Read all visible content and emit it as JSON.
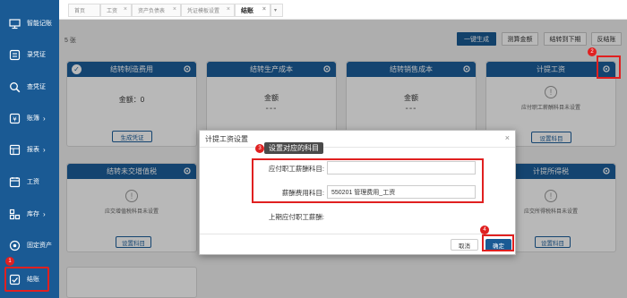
{
  "sidebar": {
    "items": [
      {
        "label": "智能记账",
        "icon": "monitor-icon",
        "chevron": ""
      },
      {
        "label": "录凭证",
        "icon": "voucher-entry-icon",
        "chevron": ""
      },
      {
        "label": "查凭证",
        "icon": "magnifier-icon",
        "chevron": ""
      },
      {
        "label": "账簿",
        "icon": "yen-ledger-icon",
        "chevron": "›"
      },
      {
        "label": "报表",
        "icon": "report-icon",
        "chevron": "›"
      },
      {
        "label": "工资",
        "icon": "salary-icon",
        "chevron": ""
      },
      {
        "label": "库存",
        "icon": "inventory-icon",
        "chevron": "›"
      },
      {
        "label": "固定资产",
        "icon": "fixed-asset-icon",
        "chevron": ""
      },
      {
        "label": "结账",
        "icon": "checkbox-icon",
        "chevron": ""
      }
    ],
    "active_index": 8
  },
  "tabs": [
    {
      "label": "首页",
      "close": ""
    },
    {
      "label": "工资",
      "close": "×"
    },
    {
      "label": "资产负债表",
      "close": "×"
    },
    {
      "label": "凭证模板设置",
      "close": "×"
    },
    {
      "label": "结账",
      "close": "×"
    },
    {
      "label": "▾",
      "close": ""
    }
  ],
  "toolbar": {
    "period_label": "5 张",
    "buttons": [
      "一键生成",
      "测算金额",
      "结转到下期",
      "反结账"
    ]
  },
  "cards": [
    {
      "title": "结转制造费用",
      "amount_label": "金额：",
      "amount": "0",
      "button": "生成凭证",
      "note": ""
    },
    {
      "title": "结转生产成本",
      "amount_label": "金额",
      "amount": "---",
      "button": "",
      "note": ""
    },
    {
      "title": "结转销售成本",
      "amount_label": "金额",
      "amount": "---",
      "button": "",
      "note": ""
    },
    {
      "title": "计提工资",
      "amount_label": "",
      "amount": "",
      "button": "设置科目",
      "note": "应付职工薪酬科目未设置"
    },
    {
      "title": "结转未交增值税",
      "amount_label": "",
      "amount": "",
      "button": "设置科目",
      "note": "应交增值税科目未设置"
    },
    {
      "title": "计提所得税",
      "amount_label": "",
      "amount": "",
      "button": "设置科目",
      "note": "应交所得税科目未设置"
    }
  ],
  "dialog": {
    "title": "计提工资设置",
    "close": "×",
    "tooltip": "设置对应的科目",
    "fields": [
      {
        "label": "应付职工薪酬科目:",
        "value": ""
      },
      {
        "label": "薪酬费用科目:",
        "value": "550201 管理费用_工资"
      },
      {
        "label": "上期应付职工薪酬:",
        "value": ""
      }
    ],
    "cancel_label": "取消",
    "ok_label": "确定"
  },
  "step_badges": [
    "1",
    "2",
    "3",
    "4"
  ],
  "colors": {
    "sidebar": "#1a5a94",
    "card_header": "#1c5f9c",
    "highlight": "#e02020"
  }
}
